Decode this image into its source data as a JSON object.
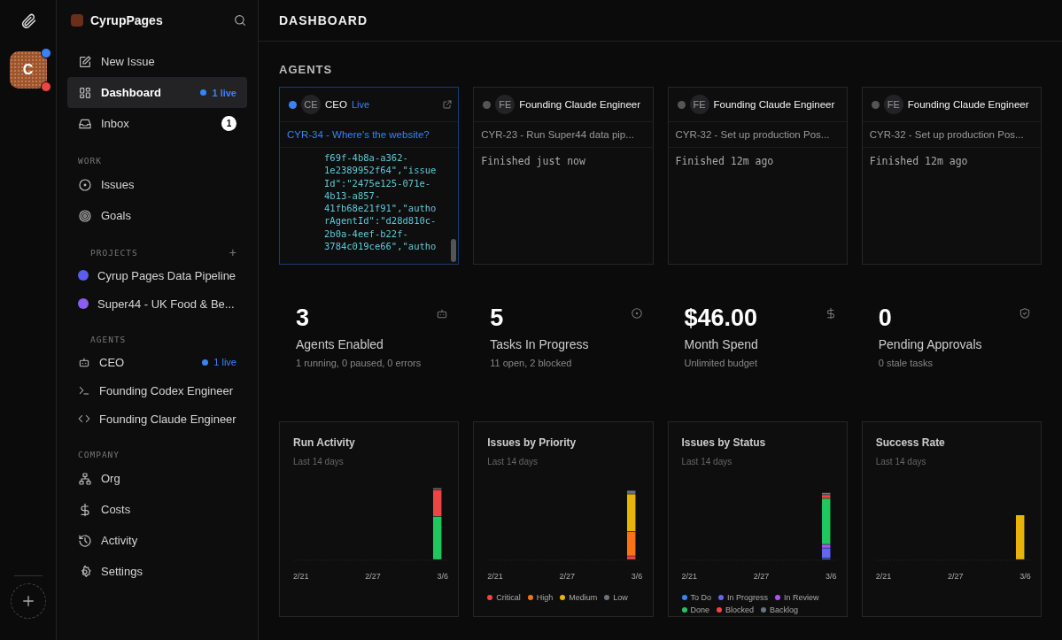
{
  "rail": {
    "company_initial": "C"
  },
  "sidebar": {
    "company": "CyrupPages",
    "nav": [
      {
        "label": "New Issue",
        "selected": false
      },
      {
        "label": "Dashboard",
        "selected": true,
        "badge": "1 live",
        "kind": "live"
      },
      {
        "label": "Inbox",
        "selected": false,
        "badge": "1",
        "kind": "count"
      }
    ],
    "sections": [
      {
        "title": "WORK",
        "kind": "nav",
        "items": [
          {
            "label": "Issues"
          },
          {
            "label": "Goals"
          }
        ]
      },
      {
        "title": "PROJECTS",
        "kind": "projects",
        "add": "+",
        "items": [
          {
            "label": "Cyrup Pages Data Pipeline",
            "color": "#5b5cf0"
          },
          {
            "label": "Super44 - UK Food & Be...",
            "color": "#8b5cf6"
          }
        ]
      },
      {
        "title": "AGENTS",
        "kind": "agents",
        "items": [
          {
            "label": "CEO",
            "badge": "1 live"
          },
          {
            "label": "Founding Codex Engineer"
          },
          {
            "label": "Founding Claude Engineer"
          }
        ]
      },
      {
        "title": "COMPANY",
        "kind": "nav",
        "items": [
          {
            "label": "Org"
          },
          {
            "label": "Costs"
          },
          {
            "label": "Activity"
          },
          {
            "label": "Settings"
          }
        ]
      }
    ]
  },
  "main": {
    "title": "DASHBOARD",
    "agents_title": "AGENTS",
    "agents": [
      {
        "initials": "CE",
        "name": "CEO",
        "live": true,
        "selected": true,
        "live_label": "Live",
        "issue": "CYR-34 - Where's the website?",
        "kind": "log",
        "log_lines": [
          "f69f-4b8a-a362-",
          "1e2389952f64\",\"issue",
          "Id\":\"2475e125-071e-",
          "4b13-a857-",
          "41fb68e21f91\",\"autho",
          "rAgentId\":\"d28d810c-",
          "2b0a-4eef-b22f-",
          "3784c019ce66\",\"autho"
        ]
      },
      {
        "initials": "FE",
        "name": "Founding Claude Engineer",
        "live": false,
        "selected": false,
        "issue": "CYR-23 - Run Super44 data pip...",
        "kind": "status",
        "status": "Finished just now"
      },
      {
        "initials": "FE",
        "name": "Founding Claude Engineer",
        "live": false,
        "selected": false,
        "issue": "CYR-32 - Set up production Pos...",
        "kind": "status",
        "status": "Finished 12m ago"
      },
      {
        "initials": "FE",
        "name": "Founding Claude Engineer",
        "live": false,
        "selected": false,
        "issue": "CYR-32 - Set up production Pos...",
        "kind": "status",
        "status": "Finished 12m ago"
      }
    ],
    "stats": [
      {
        "value": "3",
        "label": "Agents Enabled",
        "sub": "1 running, 0 paused, 0 errors"
      },
      {
        "value": "5",
        "label": "Tasks In Progress",
        "sub": "11 open, 2 blocked"
      },
      {
        "value": "$46.00",
        "label": "Month Spend",
        "sub": "Unlimited budget"
      },
      {
        "value": "0",
        "label": "Pending Approvals",
        "sub": "0 stale tasks"
      }
    ],
    "charts": [
      {
        "kind": "run",
        "title": "Run Activity",
        "subtitle": "Last 14 days",
        "x_labels": [
          "2/21",
          "2/27",
          "3/6"
        ]
      },
      {
        "kind": "priority",
        "title": "Issues by Priority",
        "subtitle": "Last 14 days",
        "x_labels": [
          "2/21",
          "2/27",
          "3/6"
        ],
        "legend": [
          {
            "label": "Critical",
            "color": "#ef4444"
          },
          {
            "label": "High",
            "color": "#f97316"
          },
          {
            "label": "Medium",
            "color": "#eab308"
          },
          {
            "label": "Low",
            "color": "#6b7280"
          }
        ]
      },
      {
        "kind": "status",
        "title": "Issues by Status",
        "subtitle": "Last 14 days",
        "x_labels": [
          "2/21",
          "2/27",
          "3/6"
        ],
        "legend": [
          {
            "label": "To Do",
            "color": "#3b82f6"
          },
          {
            "label": "In Progress",
            "color": "#6366f1"
          },
          {
            "label": "In Review",
            "color": "#a855f7"
          },
          {
            "label": "Done",
            "color": "#22c55e"
          },
          {
            "label": "Blocked",
            "color": "#ef4444"
          },
          {
            "label": "Backlog",
            "color": "#6b7280"
          }
        ]
      },
      {
        "kind": "rate",
        "title": "Success Rate",
        "subtitle": "Last 14 days",
        "x_labels": [
          "2/21",
          "2/27",
          "3/6"
        ]
      }
    ]
  }
}
